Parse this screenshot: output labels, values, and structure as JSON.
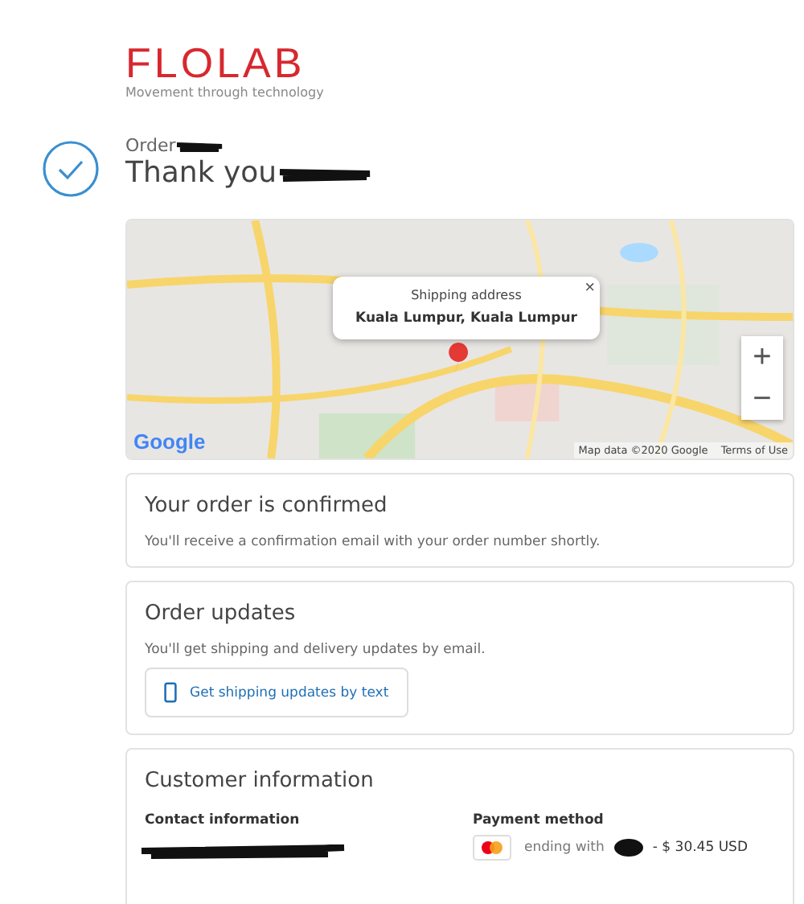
{
  "brand": {
    "logo": "FLOLAB",
    "tagline": "Movement through technology"
  },
  "header": {
    "order_label": "Order",
    "thank_you": "Thank you"
  },
  "map": {
    "popup": {
      "title": "Shipping address",
      "address": "Kuala Lumpur, Kuala Lumpur",
      "close": "×"
    },
    "zoom_in": "+",
    "zoom_out": "−",
    "google": "Google",
    "attribution": "Map data ©2020 Google",
    "terms": "Terms of Use"
  },
  "confirmed": {
    "title": "Your order is confirmed",
    "text": "You'll receive a confirmation email with your order number shortly."
  },
  "updates": {
    "title": "Order updates",
    "text": "You'll get shipping and delivery updates by email.",
    "button": "Get shipping updates by text"
  },
  "customer": {
    "title": "Customer information",
    "contact_label": "Contact information",
    "payment_label": "Payment method",
    "payment_text": "ending with",
    "amount": "- $ 30.45 USD"
  }
}
